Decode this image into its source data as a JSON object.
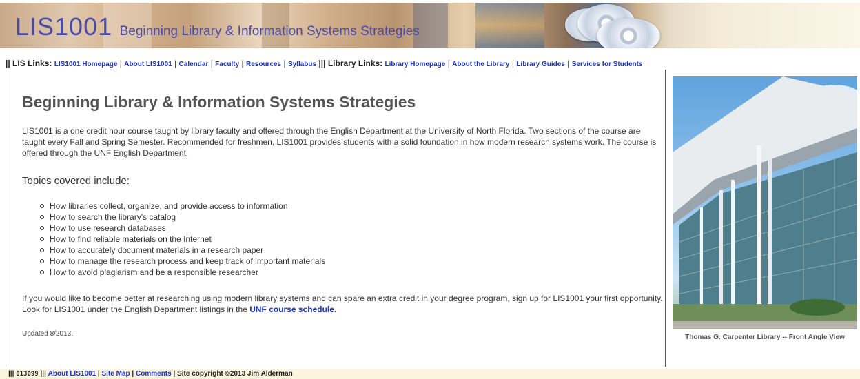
{
  "banner": {
    "code": "LIS1001",
    "tagline": "Beginning Library & Information Systems Strategies"
  },
  "nav": {
    "lis_label": "|| LIS Links:",
    "lis_links": [
      "LIS1001 Homepage",
      "About LIS1001",
      "Calendar",
      "Faculty",
      "Resources",
      "Syllabus"
    ],
    "library_label": "||| Library Links:",
    "library_links": [
      "Library Homepage",
      "About the Library",
      "Library Guides",
      "Services for Students"
    ],
    "separator": "|"
  },
  "main": {
    "title": "Beginning Library & Information Systems Strategies",
    "intro": "LIS1001 is a one credit hour course taught by library faculty and offered through the English Department at the University of North Florida. Two sections of the course are taught every Fall and Spring Semester. Recommended for freshmen, LIS1001 provides students with a solid foundation in how modern research systems work. The course is offered through the UNF English Department.",
    "topics_heading": "Topics covered include:",
    "topics": [
      "How libraries collect, organize, and provide access to information",
      "How to search the library's catalog",
      "How to use research databases",
      "How to find reliable materials on the Internet",
      "How to accurately document materials in a research paper",
      "How to manage the research process and keep track of important materials",
      "How to avoid plagiarism and be a responsible researcher"
    ],
    "outro_text": "If you would like to become better at researching using modern library systems and can spare an extra credit in your degree program, sign up for LIS1001 your first opportunity. Look for LIS1001 under the English Department listings in the",
    "outro_link": "UNF course schedule",
    "outro_end": ".",
    "updated": "Updated 8/2013."
  },
  "photo": {
    "caption": "Thomas G. Carpenter Library -- Front Angle View"
  },
  "footer": {
    "prefix": "|||",
    "counter": "013099",
    "mid": "|||",
    "links": [
      "About LIS1001",
      "Site Map",
      "Comments"
    ],
    "separator": "|",
    "copyright": "Site copyright ©2013 Jim Alderman"
  },
  "colors": {
    "link": "#1a33cc",
    "brand": "#4a4aa8",
    "footer_bg": "#fbf5de"
  }
}
